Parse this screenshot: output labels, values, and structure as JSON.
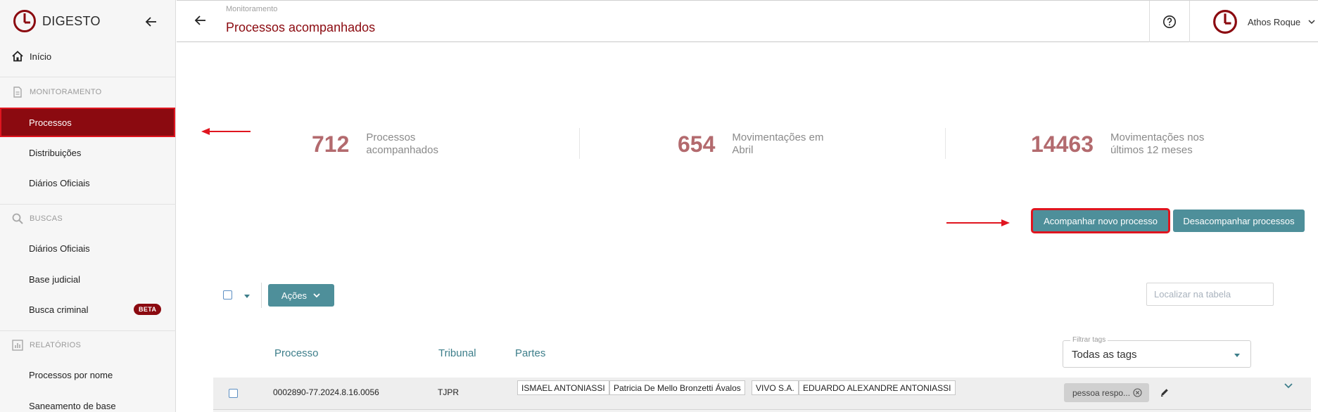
{
  "brand": {
    "name": "DIGESTO"
  },
  "sidebar": {
    "home_label": "Início",
    "sections": [
      {
        "title": "MONITORAMENTO",
        "items": [
          "Processos",
          "Distribuições",
          "Diários Oficiais"
        ]
      },
      {
        "title": "BUSCAS",
        "items": [
          "Diários Oficiais",
          "Base judicial",
          "Busca criminal"
        ]
      },
      {
        "title": "RELATÓRIOS",
        "items": [
          "Processos por nome",
          "Saneamento de base"
        ]
      }
    ],
    "active_item": "Processos",
    "beta_badge": "BETA"
  },
  "header": {
    "breadcrumb": "Monitoramento",
    "title": "Processos acompanhados",
    "user_name": "Athos Roque"
  },
  "stats": [
    {
      "value": "712",
      "line1": "Processos",
      "line2": "acompanhados"
    },
    {
      "value": "654",
      "line1": "Movimentações em",
      "line2": "Abril"
    },
    {
      "value": "14463",
      "line1": "Movimentações nos",
      "line2": "últimos 12 meses"
    }
  ],
  "actions": {
    "follow_label": "Acompanhar novo processo",
    "unfollow_label": "Desacompanhar processos"
  },
  "table": {
    "actions_label": "Ações",
    "search_placeholder": "Localizar na tabela",
    "columns": [
      "Processo",
      "Tribunal",
      "Partes"
    ],
    "tag_filter": {
      "label": "Filtrar tags",
      "value": "Todas as tags"
    },
    "rows": [
      {
        "processo": "0002890-77.2024.8.16.0056",
        "tribunal": "TJPR",
        "partes": [
          "ISMAEL ANTONIASSI",
          "Patricia De Mello Bronzetti Ávalos",
          "VIVO S.A.",
          "EDUARDO ALEXANDRE ANTONIASSI"
        ],
        "tag": "pessoa respo..."
      }
    ]
  },
  "colors": {
    "brand_red": "#8b0a10",
    "highlight_red": "#e0151f",
    "teal": "#4e8f9a",
    "stat_number": "#b36a6e"
  }
}
